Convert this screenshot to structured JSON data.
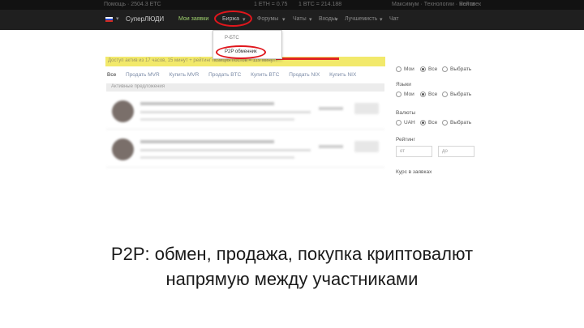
{
  "top_strip": {
    "left": "Помощь · 2504.3 ЕТС",
    "center1": "1 ETH = 0.75 ",
    "center2": "1 BTC = 214.188",
    "right1": "Максимум · Технологии · Человек",
    "right2": "Войти"
  },
  "navbar": {
    "brand": "СуперЛЮДИ",
    "items": [
      "Мои заявки",
      "Биржа",
      "Форумы",
      "Чаты",
      "Входы",
      "Лучшемисть",
      "Чат"
    ]
  },
  "dropdown": {
    "item1": "P-БТС",
    "item2": "P2P обменник"
  },
  "notice": {
    "text": "Доступ актив из 17 часов, 15 минут + рейтинг позиция постов = 119 минут?"
  },
  "tabs": [
    "Все",
    "Продать MVR",
    "Купить MVR",
    "Продать BTC",
    "Купить BTC",
    "Продать NIX",
    "Купить NIX"
  ],
  "list": {
    "header": "Активные предложения"
  },
  "filters": {
    "group1": {
      "options": [
        "Мои",
        "Все",
        "Выбрать"
      ],
      "selected": "Все"
    },
    "group2": {
      "label": "Языки",
      "options": [
        "Мои",
        "Все",
        "Выбрать"
      ],
      "selected": "Все"
    },
    "group3": {
      "label": "Валюты",
      "options": [
        "UAH",
        "Все",
        "Выбрать"
      ],
      "selected": "Все"
    },
    "rating": {
      "label": "Рейтинг",
      "from_placeholder": "от",
      "to_placeholder": "до"
    },
    "rate_label": "Курс в заявках"
  },
  "caption": {
    "line1": "P2P: обмен, продажа, покупка криптовалют",
    "line2": "напрямую между участниками"
  },
  "colors": {
    "navbar_bg": "#1f1f1f",
    "highlight_ring": "#e0161c",
    "notice_bg": "#f2e96b",
    "active_nav": "#9fd16e"
  }
}
